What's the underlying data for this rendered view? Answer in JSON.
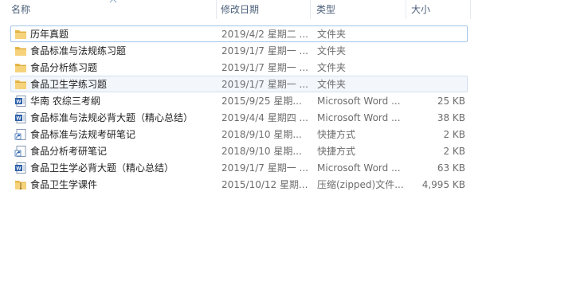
{
  "columns": {
    "name": "名称",
    "date": "修改日期",
    "type": "类型",
    "size": "大小"
  },
  "files": [
    {
      "name": "历年真题",
      "date": "2019/4/2 星期二 ...",
      "type": "文件夹",
      "size": "",
      "icon": "folder-icon"
    },
    {
      "name": "食品标准与法规练习题",
      "date": "2019/1/7 星期一 ...",
      "type": "文件夹",
      "size": "",
      "icon": "folder-icon"
    },
    {
      "name": "食品分析练习题",
      "date": "2019/1/7 星期一 ...",
      "type": "文件夹",
      "size": "",
      "icon": "folder-icon"
    },
    {
      "name": "食品卫生学练习题",
      "date": "2019/1/7 星期一 ...",
      "type": "文件夹",
      "size": "",
      "icon": "folder-icon"
    },
    {
      "name": "华南  农综三考纲",
      "date": "2015/9/25 星期...",
      "type": "Microsoft Word ...",
      "size": "25 KB",
      "icon": "word-document-icon"
    },
    {
      "name": "食品标准与法规必背大题（精心总结）",
      "date": "2019/4/4 星期四 ...",
      "type": "Microsoft Word ...",
      "size": "38 KB",
      "icon": "word-document-icon"
    },
    {
      "name": "食品标准与法规考研笔记",
      "date": "2018/9/10 星期...",
      "type": "快捷方式",
      "size": "2 KB",
      "icon": "shortcut-icon"
    },
    {
      "name": "食品分析考研笔记",
      "date": "2018/9/10 星期...",
      "type": "快捷方式",
      "size": "2 KB",
      "icon": "shortcut-icon"
    },
    {
      "name": "食品卫生学必背大题（精心总结）",
      "date": "2019/1/7 星期一 ...",
      "type": "Microsoft Word ...",
      "size": "63 KB",
      "icon": "word-document-icon"
    },
    {
      "name": "食品卫生学课件",
      "date": "2015/10/12 星期...",
      "type": "压缩(zipped)文件...",
      "size": "4,995 KB",
      "icon": "zip-folder-icon"
    }
  ]
}
